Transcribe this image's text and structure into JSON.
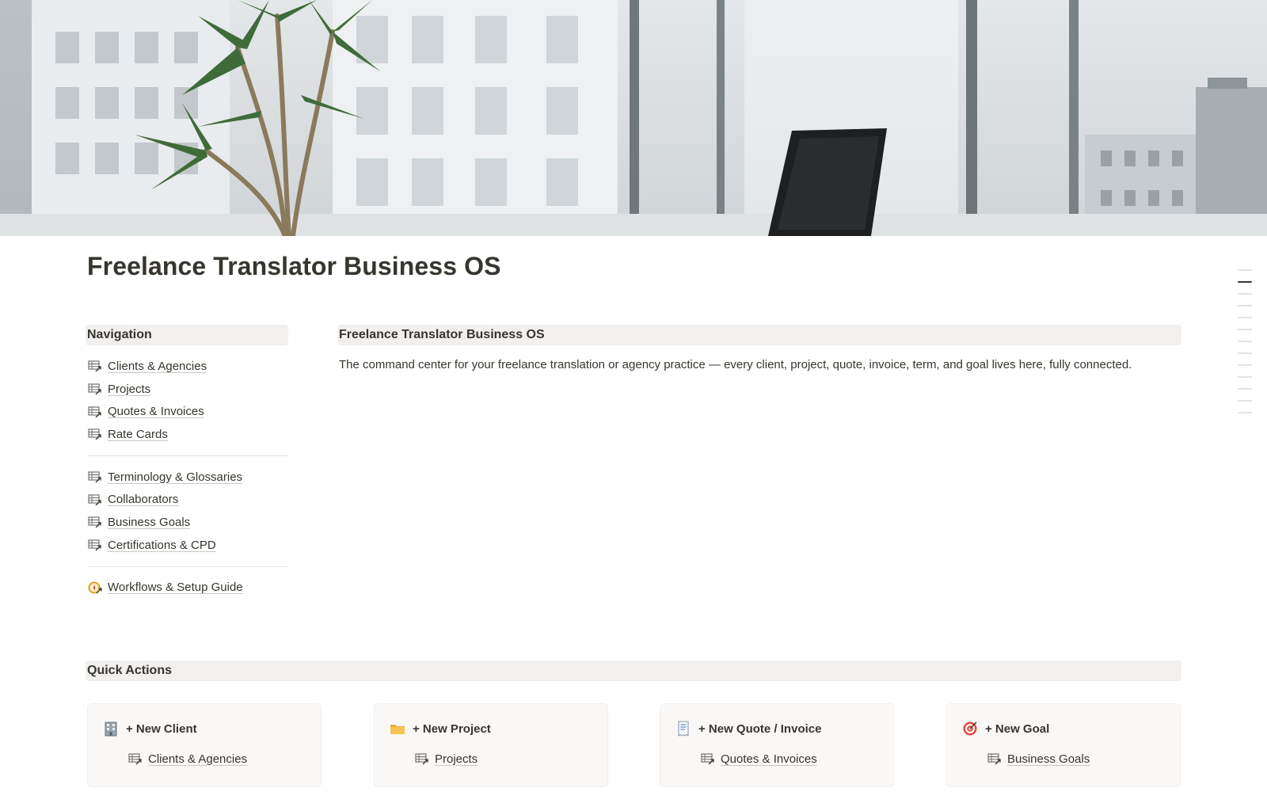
{
  "page": {
    "title": "Freelance Translator Business OS"
  },
  "navigation": {
    "heading": "Navigation",
    "groups": [
      [
        {
          "label": "Clients & Agencies",
          "icon": "database-link-icon"
        },
        {
          "label": "Projects",
          "icon": "database-link-icon"
        },
        {
          "label": "Quotes & Invoices",
          "icon": "database-link-icon"
        },
        {
          "label": "Rate Cards",
          "icon": "database-link-icon"
        }
      ],
      [
        {
          "label": "Terminology & Glossaries",
          "icon": "database-link-icon"
        },
        {
          "label": "Collaborators",
          "icon": "database-link-icon"
        },
        {
          "label": "Business Goals",
          "icon": "database-link-icon"
        },
        {
          "label": "Certifications & CPD",
          "icon": "database-link-icon"
        }
      ],
      [
        {
          "label": "Workflows & Setup Guide",
          "icon": "compass-icon"
        }
      ]
    ]
  },
  "overview": {
    "heading": "Freelance Translator Business OS",
    "description": "The command center for your freelance translation or agency practice — every client, project, quote, invoice, term, and goal lives here, fully connected."
  },
  "quick_actions": {
    "heading": "Quick Actions",
    "cards": [
      {
        "title": "+ New Client",
        "emoji_icon": "office-building-icon",
        "link": "Clients & Agencies"
      },
      {
        "title": "+ New Project",
        "emoji_icon": "folder-icon",
        "link": "Projects"
      },
      {
        "title": "+ New Quote / Invoice",
        "emoji_icon": "receipt-icon",
        "link": "Quotes & Invoices"
      },
      {
        "title": "+ New Goal",
        "emoji_icon": "target-icon",
        "link": "Business Goals"
      }
    ]
  },
  "colors": {
    "text": "#37352f",
    "bar_background": "#f1f0ef",
    "card_background": "#f9f8f7"
  }
}
